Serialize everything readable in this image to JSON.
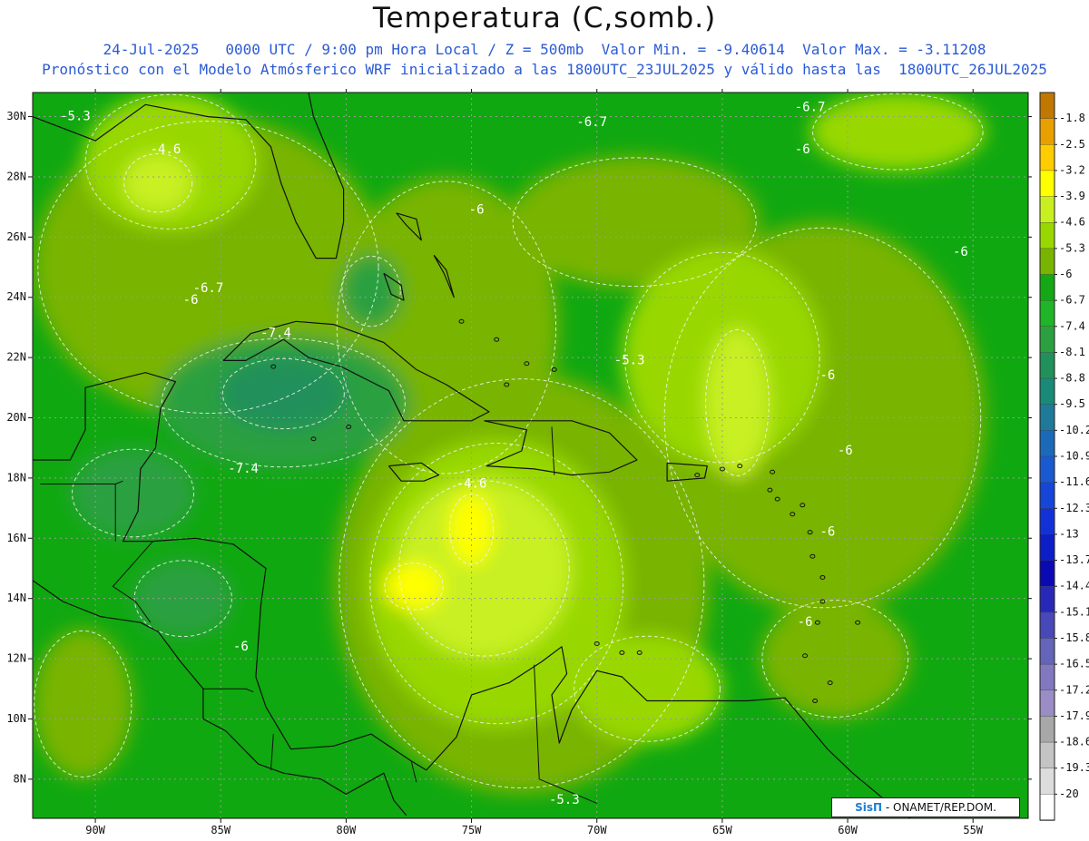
{
  "title": "Temperatura (C,somb.)",
  "subtitle_line1": "24-Jul-2025   0000 UTC / 9:00 pm Hora Local / Z = 500mb  Valor Min. = -9.40614  Valor Max. = -3.11208",
  "subtitle_line2": "Pronóstico con el Modelo Atmósferico WRF inicializado a las 1800UTC_23JUL2025 y válido hasta las  1800UTC_26JUL2025",
  "credit": {
    "brand": "SisΠ",
    "text": "- ONAMET/REP.DOM."
  },
  "map": {
    "lon_range": [
      -92.5,
      -52.8
    ],
    "lat_range": [
      6.7,
      30.8
    ],
    "lon_ticks": [
      -90,
      -85,
      -80,
      -75,
      -70,
      -65,
      -60,
      -55
    ],
    "lon_tick_labels": [
      "90W",
      "85W",
      "80W",
      "75W",
      "70W",
      "65W",
      "60W",
      "55W"
    ],
    "lat_ticks": [
      8,
      10,
      12,
      14,
      16,
      18,
      20,
      22,
      24,
      26,
      28,
      30
    ],
    "lat_tick_labels": [
      "8N",
      "10N",
      "12N",
      "14N",
      "16N",
      "18N",
      "20N",
      "22N",
      "24N",
      "26N",
      "28N",
      "30N"
    ],
    "background_color": "#10a810"
  },
  "colorbar": {
    "labels": [
      "-1.8",
      "-2.5",
      "-3.2",
      "-3.9",
      "-4.6",
      "-5.3",
      "-6",
      "-6.7",
      "-7.4",
      "-8.1",
      "-8.8",
      "-9.5",
      "-10.2",
      "-10.9",
      "-11.6",
      "-12.3",
      "-13",
      "-13.7",
      "-14.4",
      "-15.1",
      "-15.8",
      "-16.5",
      "-17.2",
      "-17.9",
      "-18.6",
      "-19.3",
      "-20"
    ],
    "colors": [
      "#c07800",
      "#e8a000",
      "#ffcc00",
      "#ffff00",
      "#c8f020",
      "#98d800",
      "#78b400",
      "#14a814",
      "#20b428",
      "#2ca040",
      "#22905a",
      "#1a8a78",
      "#1e7a98",
      "#1a6ab8",
      "#1a5ad0",
      "#1646d8",
      "#1232d8",
      "#0c1ec8",
      "#0a0ab4",
      "#2828b8",
      "#4848b8",
      "#6464b8",
      "#8278c0",
      "#9a8cc4",
      "#a8a8a8",
      "#c4c4c4",
      "#dcdcdc",
      "#ffffff"
    ]
  },
  "regions": [
    {
      "color": "#78b400",
      "lon": -85.5,
      "lat": 25.0,
      "rx": 7.0,
      "ry": 5.0
    },
    {
      "color": "#78b400",
      "lon": -76.0,
      "lat": 23.0,
      "rx": 4.5,
      "ry": 5.0
    },
    {
      "color": "#98d800",
      "lon": -87.0,
      "lat": 28.5,
      "rx": 3.5,
      "ry": 2.3
    },
    {
      "color": "#c8f020",
      "lon": -87.5,
      "lat": 27.8,
      "rx": 1.4,
      "ry": 1.0
    },
    {
      "color": "#78b400",
      "lon": -68.5,
      "lat": 26.5,
      "rx": 5.0,
      "ry": 2.2
    },
    {
      "color": "#78b400",
      "lon": -61.0,
      "lat": 20.0,
      "rx": 6.5,
      "ry": 6.5
    },
    {
      "color": "#98d800",
      "lon": -65.0,
      "lat": 22.0,
      "rx": 4.0,
      "ry": 3.6
    },
    {
      "color": "#c8f020",
      "lon": -64.4,
      "lat": 20.5,
      "rx": 1.3,
      "ry": 2.5
    },
    {
      "color": "#78b400",
      "lon": -73.0,
      "lat": 14.5,
      "rx": 7.5,
      "ry": 7.0
    },
    {
      "color": "#98d800",
      "lon": -74.0,
      "lat": 14.5,
      "rx": 5.2,
      "ry": 4.8
    },
    {
      "color": "#c8f020",
      "lon": -74.5,
      "lat": 15.0,
      "rx": 3.5,
      "ry": 3.0
    },
    {
      "color": "#ffff00",
      "lon": -75.0,
      "lat": 16.3,
      "rx": 0.9,
      "ry": 1.2
    },
    {
      "color": "#ffff00",
      "lon": -77.3,
      "lat": 14.4,
      "rx": 1.2,
      "ry": 0.8
    },
    {
      "color": "#2ca040",
      "lon": -82.5,
      "lat": 20.5,
      "rx": 5.0,
      "ry": 2.2
    },
    {
      "color": "#22905a",
      "lon": -82.5,
      "lat": 20.8,
      "rx": 2.5,
      "ry": 1.2
    },
    {
      "color": "#2ca040",
      "lon": -79.0,
      "lat": 24.2,
      "rx": 1.2,
      "ry": 1.2
    },
    {
      "color": "#2ca040",
      "lon": -88.5,
      "lat": 17.5,
      "rx": 2.5,
      "ry": 1.5
    },
    {
      "color": "#2ca040",
      "lon": -86.5,
      "lat": 14.0,
      "rx": 2.0,
      "ry": 1.3
    },
    {
      "color": "#78b400",
      "lon": -90.5,
      "lat": 10.5,
      "rx": 2.0,
      "ry": 2.5
    },
    {
      "color": "#98d800",
      "lon": -68.0,
      "lat": 11.0,
      "rx": 3.0,
      "ry": 1.8
    },
    {
      "color": "#78b400",
      "lon": -60.5,
      "lat": 12.0,
      "rx": 3.0,
      "ry": 2.0
    },
    {
      "color": "#98d800",
      "lon": -58.0,
      "lat": 29.5,
      "rx": 3.5,
      "ry": 1.3
    }
  ],
  "contour_labels": [
    {
      "text": "-5.3",
      "lon": -90.8,
      "lat": 30.0
    },
    {
      "text": "-4.6",
      "lon": -87.2,
      "lat": 28.9
    },
    {
      "text": "-6.7",
      "lon": -70.2,
      "lat": 29.8
    },
    {
      "text": "-6.7",
      "lon": -61.5,
      "lat": 30.3
    },
    {
      "text": "-6",
      "lon": -61.8,
      "lat": 28.9
    },
    {
      "text": "-6",
      "lon": -74.8,
      "lat": 26.9
    },
    {
      "text": "-6",
      "lon": -55.5,
      "lat": 25.5
    },
    {
      "text": "-6.7",
      "lon": -85.5,
      "lat": 24.3
    },
    {
      "text": "-6",
      "lon": -86.2,
      "lat": 23.9
    },
    {
      "text": "-7.4",
      "lon": -82.8,
      "lat": 22.8
    },
    {
      "text": "-5.3",
      "lon": -68.7,
      "lat": 21.9
    },
    {
      "text": "-6",
      "lon": -60.8,
      "lat": 21.4
    },
    {
      "text": "-6",
      "lon": -60.1,
      "lat": 18.9
    },
    {
      "text": "-7.4",
      "lon": -84.1,
      "lat": 18.3
    },
    {
      "text": "-4.6",
      "lon": -75.0,
      "lat": 17.8
    },
    {
      "text": "-6",
      "lon": -60.8,
      "lat": 16.2
    },
    {
      "text": "-6",
      "lon": -61.7,
      "lat": 13.2
    },
    {
      "text": "-6",
      "lon": -84.2,
      "lat": 12.4
    },
    {
      "text": "-5.3",
      "lon": -71.3,
      "lat": 7.3
    }
  ],
  "coastlines": [
    [
      [
        -92.5,
        30.0
      ],
      [
        -90.0,
        29.2
      ],
      [
        -88.0,
        30.4
      ],
      [
        -85.5,
        30.0
      ],
      [
        -84.0,
        29.9
      ],
      [
        -83.0,
        29.0
      ],
      [
        -82.6,
        27.8
      ],
      [
        -82.0,
        26.5
      ],
      [
        -81.2,
        25.3
      ],
      [
        -80.4,
        25.3
      ],
      [
        -80.1,
        26.5
      ],
      [
        -80.1,
        27.6
      ],
      [
        -80.6,
        28.6
      ],
      [
        -81.3,
        30.0
      ],
      [
        -81.5,
        30.8
      ]
    ],
    [
      [
        -92.5,
        18.6
      ],
      [
        -91.0,
        18.6
      ],
      [
        -90.4,
        19.6
      ],
      [
        -90.4,
        21.0
      ],
      [
        -88.0,
        21.5
      ],
      [
        -86.8,
        21.2
      ],
      [
        -87.4,
        20.3
      ],
      [
        -87.6,
        19.0
      ],
      [
        -88.2,
        18.3
      ],
      [
        -88.3,
        16.9
      ],
      [
        -88.9,
        15.9
      ],
      [
        -87.7,
        15.9
      ],
      [
        -86.0,
        16.0
      ],
      [
        -84.5,
        15.8
      ],
      [
        -83.2,
        15.0
      ],
      [
        -83.4,
        13.8
      ],
      [
        -83.6,
        11.4
      ],
      [
        -83.2,
        10.4
      ],
      [
        -82.2,
        9.0
      ],
      [
        -80.5,
        9.1
      ],
      [
        -79.0,
        9.5
      ],
      [
        -77.4,
        8.6
      ],
      [
        -76.8,
        8.3
      ]
    ],
    [
      [
        -92.5,
        14.6
      ],
      [
        -91.3,
        13.9
      ],
      [
        -89.8,
        13.4
      ],
      [
        -88.2,
        13.2
      ],
      [
        -87.5,
        12.9
      ],
      [
        -86.6,
        11.9
      ],
      [
        -85.7,
        11.0
      ],
      [
        -85.7,
        10.0
      ],
      [
        -84.8,
        9.6
      ],
      [
        -83.5,
        8.5
      ],
      [
        -82.5,
        8.2
      ],
      [
        -81.0,
        8.0
      ],
      [
        -80.0,
        7.5
      ],
      [
        -78.5,
        8.2
      ],
      [
        -78.1,
        7.3
      ],
      [
        -77.6,
        6.8
      ]
    ],
    [
      [
        -76.8,
        8.3
      ],
      [
        -75.6,
        9.4
      ],
      [
        -75.0,
        10.8
      ],
      [
        -73.5,
        11.2
      ],
      [
        -72.2,
        11.9
      ],
      [
        -71.4,
        12.4
      ],
      [
        -71.2,
        11.5
      ],
      [
        -71.8,
        10.8
      ],
      [
        -71.5,
        9.2
      ],
      [
        -71.0,
        10.3
      ],
      [
        -70.0,
        11.6
      ],
      [
        -69.0,
        11.4
      ],
      [
        -68.0,
        10.6
      ],
      [
        -66.0,
        10.6
      ],
      [
        -64.0,
        10.6
      ],
      [
        -62.5,
        10.7
      ],
      [
        -61.8,
        10.0
      ],
      [
        -60.8,
        9.0
      ],
      [
        -59.8,
        8.2
      ],
      [
        -58.5,
        7.3
      ],
      [
        -57.5,
        6.7
      ]
    ],
    [
      [
        -84.9,
        21.9
      ],
      [
        -83.8,
        22.8
      ],
      [
        -82.0,
        23.2
      ],
      [
        -80.5,
        23.1
      ],
      [
        -78.5,
        22.5
      ],
      [
        -77.2,
        21.6
      ],
      [
        -76.0,
        21.1
      ],
      [
        -74.3,
        20.2
      ],
      [
        -75.0,
        19.9
      ],
      [
        -76.7,
        19.9
      ],
      [
        -77.7,
        19.9
      ],
      [
        -78.3,
        20.9
      ],
      [
        -80.2,
        21.7
      ],
      [
        -81.5,
        22.0
      ],
      [
        -82.5,
        22.6
      ],
      [
        -84.0,
        21.9
      ],
      [
        -84.9,
        21.9
      ]
    ],
    [
      [
        -74.5,
        19.9
      ],
      [
        -72.5,
        19.9
      ],
      [
        -71.0,
        19.9
      ],
      [
        -69.5,
        19.5
      ],
      [
        -68.4,
        18.6
      ],
      [
        -69.5,
        18.2
      ],
      [
        -71.0,
        18.1
      ],
      [
        -72.5,
        18.3
      ],
      [
        -74.4,
        18.4
      ],
      [
        -73.0,
        18.9
      ],
      [
        -72.8,
        19.6
      ],
      [
        -74.5,
        19.9
      ]
    ],
    [
      [
        -78.3,
        18.4
      ],
      [
        -77.0,
        18.5
      ],
      [
        -76.3,
        18.1
      ],
      [
        -76.9,
        17.9
      ],
      [
        -77.8,
        17.9
      ],
      [
        -78.3,
        18.4
      ]
    ],
    [
      [
        -67.2,
        18.5
      ],
      [
        -65.6,
        18.4
      ],
      [
        -65.7,
        18.0
      ],
      [
        -67.2,
        17.9
      ],
      [
        -67.2,
        18.5
      ]
    ],
    [
      [
        -78.0,
        26.8
      ],
      [
        -77.2,
        26.6
      ],
      [
        -77.0,
        25.9
      ],
      [
        -77.6,
        26.4
      ],
      [
        -78.0,
        26.8
      ]
    ],
    [
      [
        -78.5,
        24.8
      ],
      [
        -77.8,
        24.4
      ],
      [
        -77.7,
        23.9
      ],
      [
        -78.2,
        24.1
      ],
      [
        -78.5,
        24.8
      ]
    ],
    [
      [
        -76.5,
        25.4
      ],
      [
        -76.1,
        24.8
      ],
      [
        -75.7,
        24.0
      ],
      [
        -76.0,
        24.9
      ],
      [
        -76.5,
        25.4
      ]
    ]
  ],
  "borders": [
    [
      [
        -92.2,
        17.8
      ],
      [
        -89.2,
        17.8
      ],
      [
        -89.2,
        15.9
      ]
    ],
    [
      [
        -89.2,
        17.8
      ],
      [
        -88.9,
        17.9
      ]
    ],
    [
      [
        -87.7,
        15.9
      ],
      [
        -89.3,
        14.4
      ],
      [
        -88.4,
        13.9
      ],
      [
        -87.8,
        13.2
      ]
    ],
    [
      [
        -85.7,
        11.0
      ],
      [
        -84.0,
        11.0
      ],
      [
        -83.7,
        10.9
      ]
    ],
    [
      [
        -83.0,
        8.3
      ],
      [
        -82.9,
        9.5
      ]
    ],
    [
      [
        -77.4,
        8.6
      ],
      [
        -77.2,
        7.9
      ]
    ],
    [
      [
        -72.5,
        11.8
      ],
      [
        -72.3,
        8.0
      ],
      [
        -70.0,
        7.2
      ]
    ],
    [
      [
        -71.7,
        18.1
      ],
      [
        -71.8,
        19.7
      ]
    ]
  ],
  "small_islands": [
    {
      "lon": -61.8,
      "lat": 17.1
    },
    {
      "lon": -62.8,
      "lat": 17.3
    },
    {
      "lon": -61.5,
      "lat": 16.2
    },
    {
      "lon": -61.4,
      "lat": 15.4
    },
    {
      "lon": -61.0,
      "lat": 14.7
    },
    {
      "lon": -61.0,
      "lat": 13.9
    },
    {
      "lon": -61.2,
      "lat": 13.2
    },
    {
      "lon": -61.7,
      "lat": 12.1
    },
    {
      "lon": -59.6,
      "lat": 13.2
    },
    {
      "lon": -61.3,
      "lat": 10.6
    },
    {
      "lon": -60.7,
      "lat": 11.2
    },
    {
      "lon": -64.3,
      "lat": 18.4
    },
    {
      "lon": -63.0,
      "lat": 18.2
    },
    {
      "lon": -69.0,
      "lat": 12.2
    },
    {
      "lon": -68.3,
      "lat": 12.2
    },
    {
      "lon": -70.0,
      "lat": 12.5
    },
    {
      "lon": -81.3,
      "lat": 19.3
    },
    {
      "lon": -79.9,
      "lat": 19.7
    },
    {
      "lon": -82.9,
      "lat": 21.7
    },
    {
      "lon": -72.8,
      "lat": 21.8
    },
    {
      "lon": -73.6,
      "lat": 21.1
    },
    {
      "lon": -71.7,
      "lat": 21.6
    },
    {
      "lon": -74.0,
      "lat": 22.6
    },
    {
      "lon": -75.4,
      "lat": 23.2
    },
    {
      "lon": -63.1,
      "lat": 17.6
    },
    {
      "lon": -62.2,
      "lat": 16.8
    },
    {
      "lon": -65.0,
      "lat": 18.3
    },
    {
      "lon": -66.0,
      "lat": 18.1
    }
  ]
}
